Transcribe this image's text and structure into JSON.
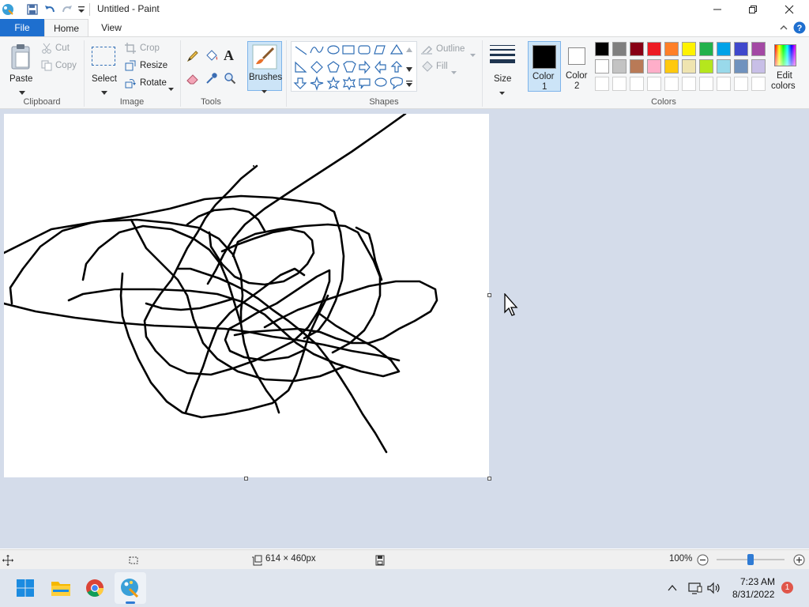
{
  "window": {
    "title": "Untitled - Paint"
  },
  "tabs": [
    {
      "label": "File"
    },
    {
      "label": "Home"
    },
    {
      "label": "View"
    }
  ],
  "clipboard": {
    "paste": "Paste",
    "cut": "Cut",
    "copy": "Copy",
    "group": "Clipboard"
  },
  "image": {
    "select": "Select",
    "crop": "Crop",
    "resize": "Resize",
    "rotate": "Rotate",
    "group": "Image"
  },
  "tools": {
    "group": "Tools"
  },
  "brushes": {
    "label": "Brushes"
  },
  "shapes": {
    "outline": "Outline",
    "fill": "Fill",
    "group": "Shapes"
  },
  "size": {
    "label": "Size"
  },
  "colors": {
    "color1_line1": "Color",
    "color1_line2": "1",
    "color2_line1": "Color",
    "color2_line2": "2",
    "edit_line1": "Edit",
    "edit_line2": "colors",
    "group": "Colors",
    "color1_value": "#000000",
    "color2_value": "#ffffff",
    "palette_row1": [
      "#000000",
      "#7f7f7f",
      "#880015",
      "#ed1c24",
      "#ff7f27",
      "#fff200",
      "#22b14c",
      "#00a2e8",
      "#3f48cc",
      "#a349a4"
    ],
    "palette_row2": [
      "#ffffff",
      "#c3c3c3",
      "#b97a57",
      "#ffaec9",
      "#ffc90e",
      "#efe4b0",
      "#b5e61d",
      "#99d9ea",
      "#7092be",
      "#c8bfe7"
    ]
  },
  "status": {
    "dimensions": "614 × 460px",
    "zoom": "100%",
    "zoom_level": 0.5
  },
  "taskbar": {
    "time": "7:23 AM",
    "date": "8/31/2022",
    "notifications": "1"
  }
}
